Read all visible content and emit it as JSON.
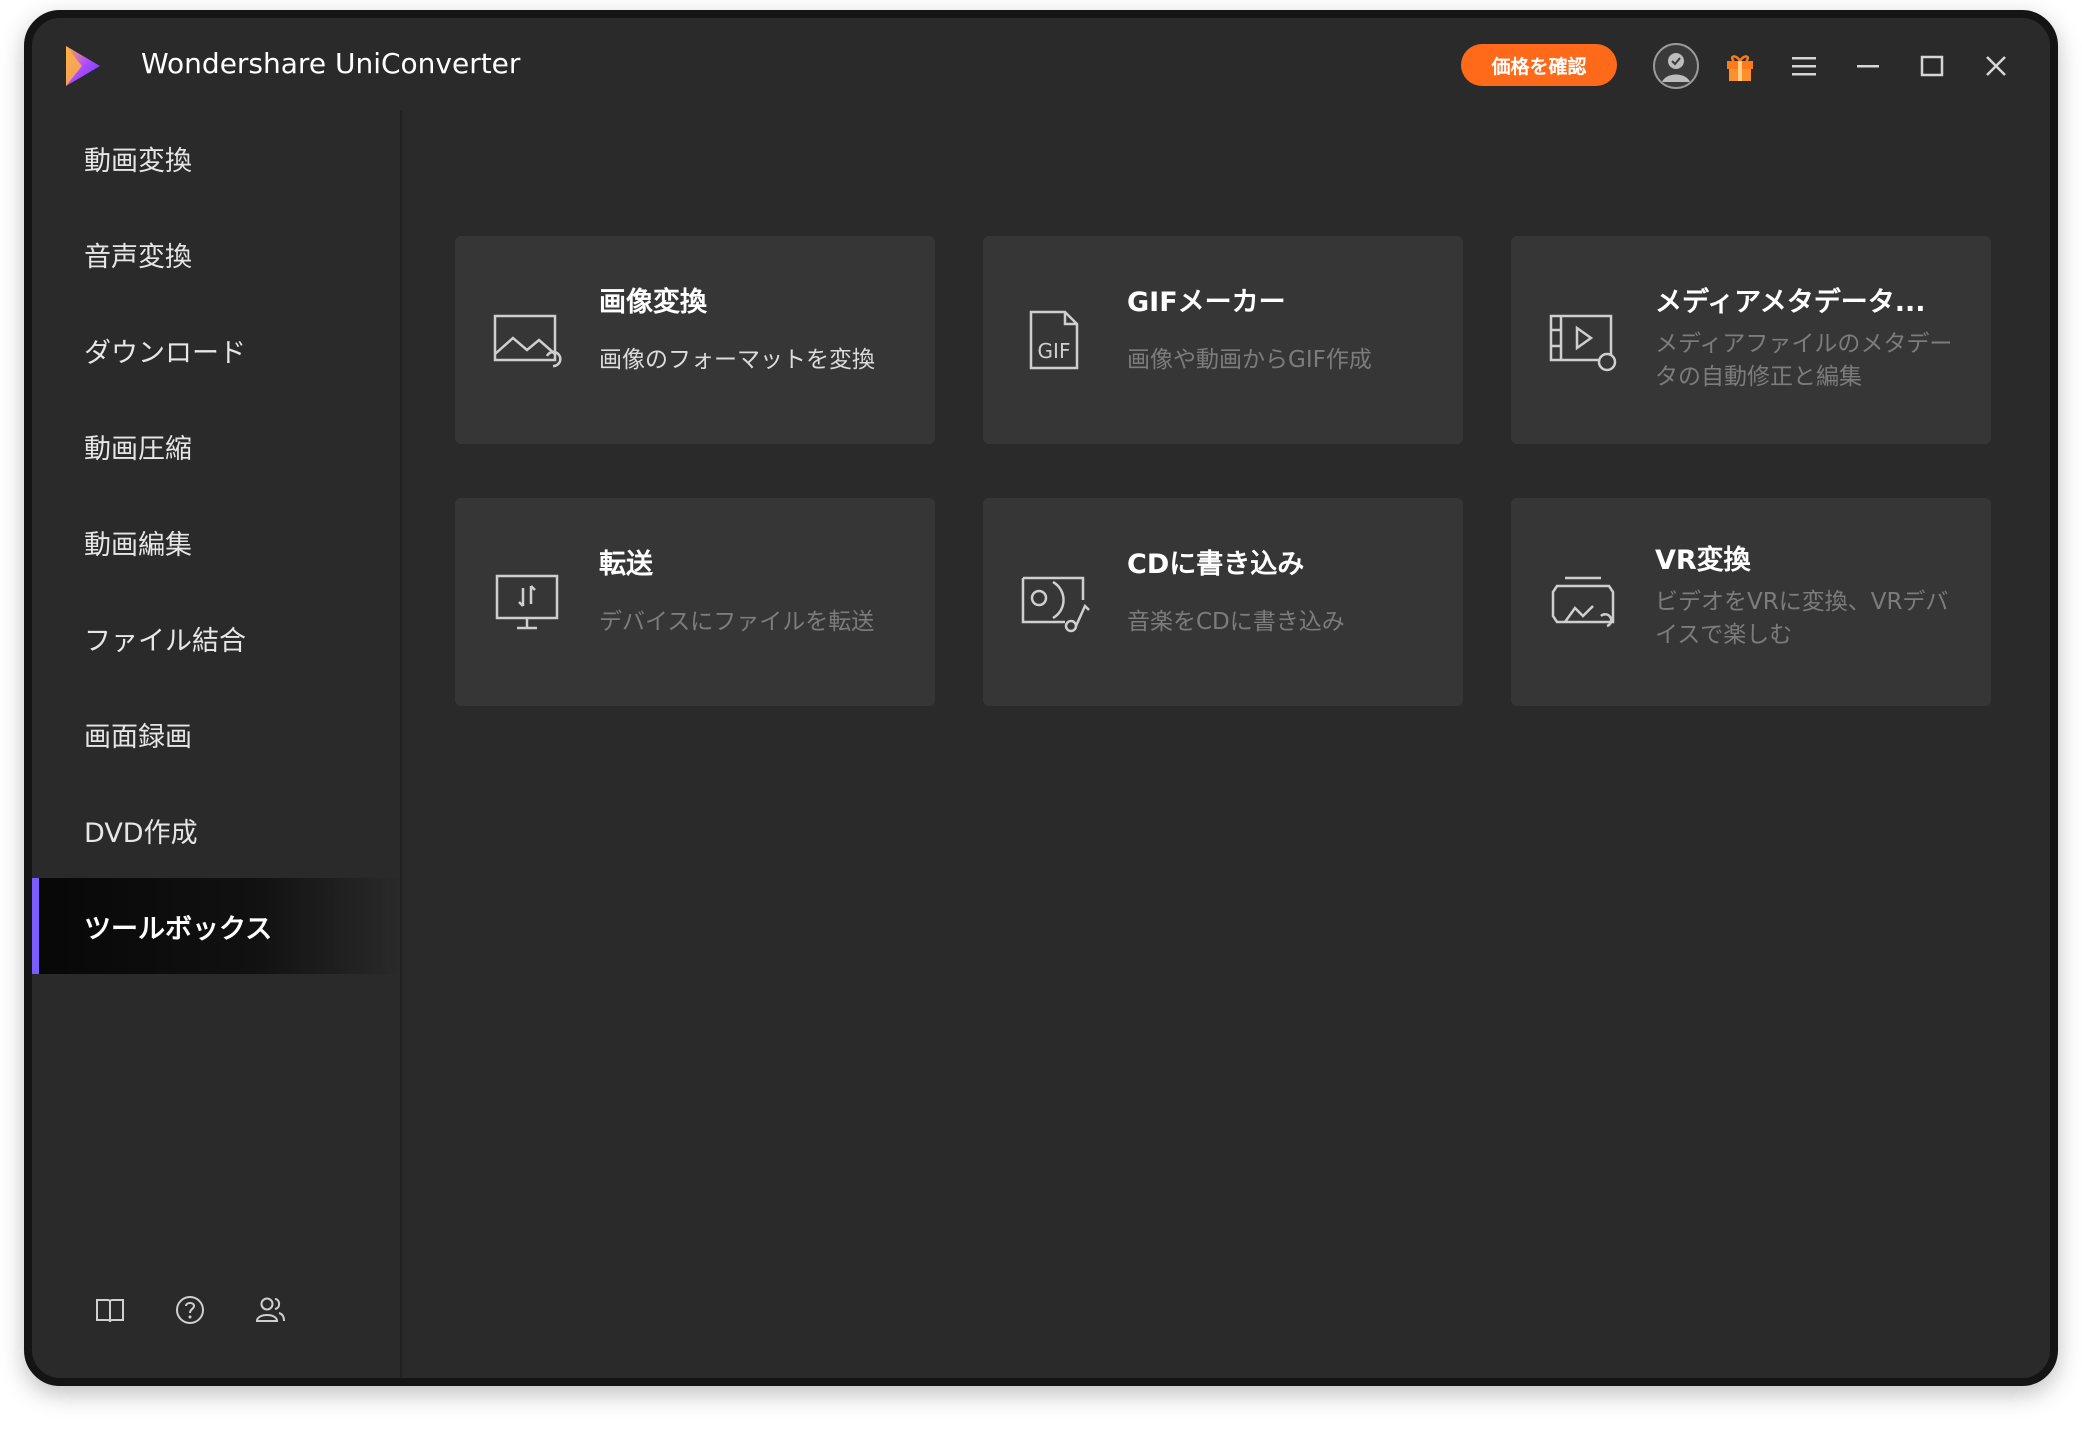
{
  "app": {
    "title": "Wondershare UniConverter"
  },
  "header": {
    "price_button": "価格を確認"
  },
  "sidebar": {
    "items": [
      {
        "label": "動画変換"
      },
      {
        "label": "音声変換"
      },
      {
        "label": "ダウンロード"
      },
      {
        "label": "動画圧縮"
      },
      {
        "label": "動画編集"
      },
      {
        "label": "ファイル結合"
      },
      {
        "label": "画面録画"
      },
      {
        "label": "DVD作成"
      },
      {
        "label": "ツールボックス",
        "active": true
      }
    ],
    "bottom_icons": [
      "book-icon",
      "help-icon",
      "community-icon"
    ]
  },
  "tools": [
    {
      "title": "画像変換",
      "desc": "画像のフォーマットを変換",
      "icon": "image-convert-icon"
    },
    {
      "title": "GIFメーカー",
      "desc": "画像や動画からGIF作成",
      "icon": "gif-icon"
    },
    {
      "title": "メディアメタデータ...",
      "desc": "メディアファイルのメタデータの自動修正と編集",
      "icon": "metadata-icon"
    },
    {
      "title": "転送",
      "desc": "デバイスにファイルを転送",
      "icon": "transfer-icon"
    },
    {
      "title": "CDに書き込み",
      "desc": "音楽をCDに書き込み",
      "icon": "cd-burn-icon"
    },
    {
      "title": "VR変換",
      "desc": "ビデオをVRに変換、VRデバイスで楽しむ",
      "icon": "vr-icon"
    }
  ],
  "colors": {
    "accent": "#7b5cff",
    "price": "#ff6a1a",
    "card": "#363636",
    "bg": "#2a2a2a"
  }
}
